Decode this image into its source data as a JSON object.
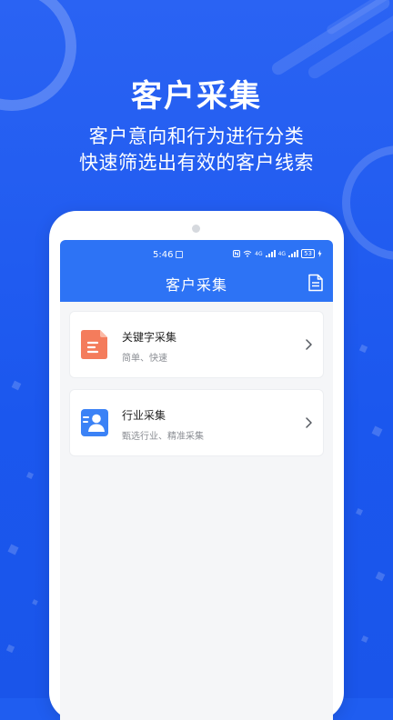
{
  "hero": {
    "title": "客户采集",
    "subtitle_line1": "客户意向和行为进行分类",
    "subtitle_line2": "快速筛选出有效的客户线索"
  },
  "status_bar": {
    "time": "5:46",
    "net_1": "4G",
    "net_2": "4G",
    "battery": "53"
  },
  "app": {
    "title": "客户采集",
    "cards": [
      {
        "title": "关键字采集",
        "subtitle": "简单、快速",
        "icon": "document-icon",
        "color": "#f47c5c"
      },
      {
        "title": "行业采集",
        "subtitle": "甄选行业、精准采集",
        "icon": "contact-card-icon",
        "color": "#3b82f6"
      }
    ]
  },
  "colors": {
    "background": "#1f5df0",
    "app_bar": "#2d73f5"
  }
}
